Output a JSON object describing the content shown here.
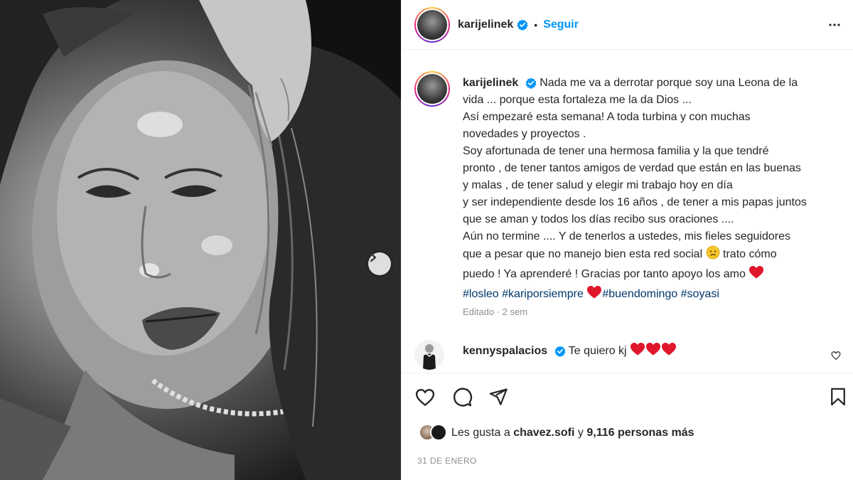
{
  "post": {
    "username": "karijelinek",
    "follow_label": "Seguir",
    "dot": "•",
    "caption_lines": [
      "Nada me va a derrotar porque soy una Leona de la",
      "vida ... porque esta fortaleza me la da Dios ...",
      "Así empezaré esta semana! A toda turbina y con muchas",
      "novedades y proyectos .",
      "Soy afortunada de tener una hermosa familia y la que tendré",
      "pronto , de tener tantos amigos de verdad que están en las buenas",
      "y malas , de tener salud y elegir mi trabajo hoy en día",
      "y ser independiente desde los 16 años , de tener a mis papas juntos",
      "que se aman y todos los días recibo sus oraciones ....",
      "Aún no termine .... Y de tenerlos a ustedes, mis fieles seguidores",
      "que a pesar que no manejo bien esta red social",
      "trato cómo",
      "puedo ! Ya aprenderé ! Gracias por tanto apoyo los amo"
    ],
    "hashtags": [
      "#losleo",
      "#kariporsiempre",
      "#buendomingo",
      "#soyasi"
    ],
    "edited_meta": "Editado · 2 sem",
    "comment": {
      "username": "kennyspalacios",
      "text": "Te quiero kj"
    },
    "likes": {
      "prefix": "Les gusta a",
      "user": "chavez.sofi",
      "middle": "y",
      "count": "9,116 personas más"
    },
    "date": "31 DE ENERO"
  },
  "colors": {
    "accent_blue": "#0095f6",
    "hashtag_blue": "#00376b",
    "heart_red": "#ed4956",
    "muted_gray": "#8e8e8e"
  },
  "icons": [
    "next-arrow-icon",
    "verified-badge-icon",
    "more-options-icon",
    "heart-icon",
    "comment-icon",
    "share-icon",
    "bookmark-icon",
    "sad-face-emoji",
    "red-heart-emoji"
  ]
}
